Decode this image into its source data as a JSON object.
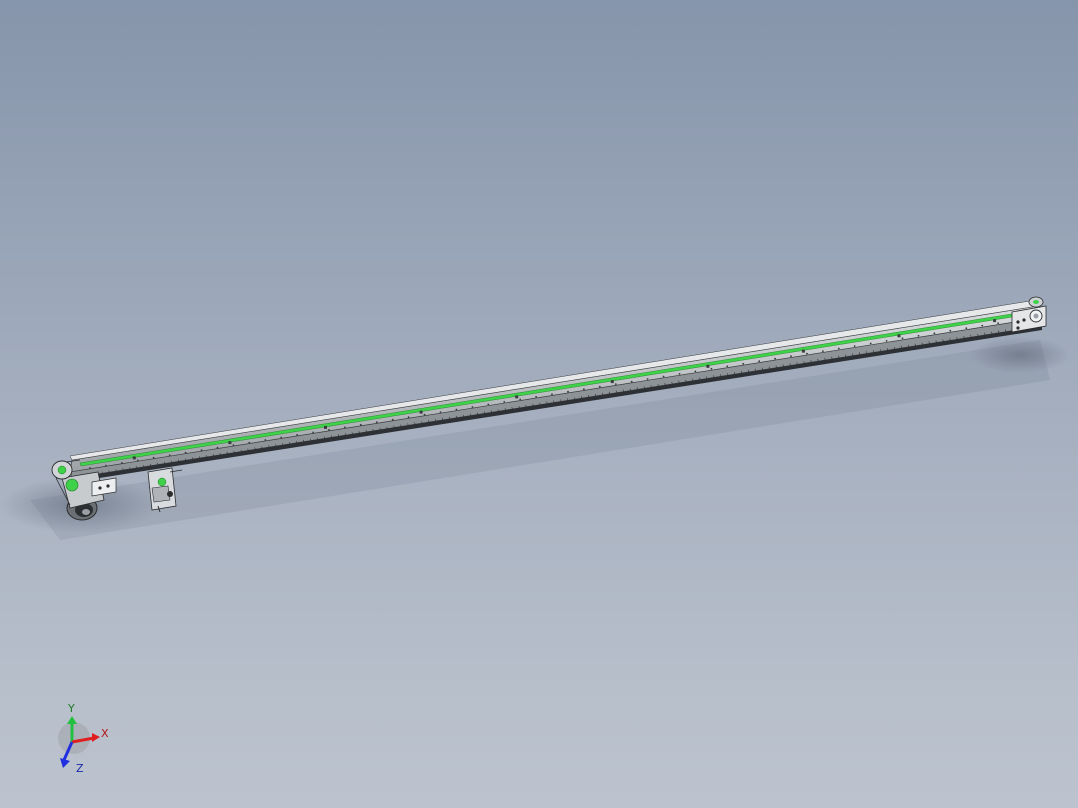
{
  "viewport": {
    "background_top": "#8695ab",
    "background_bottom": "#bcc3ce"
  },
  "model": {
    "belt_color": "#3fd14a",
    "frame_color": "#b9bdc0",
    "outline_color": "#3a3d40"
  },
  "triad": {
    "x_label": "X",
    "y_label": "Y",
    "z_label": "Z",
    "x_color": "#e02020",
    "y_color": "#22c040",
    "z_color": "#2030e0"
  }
}
